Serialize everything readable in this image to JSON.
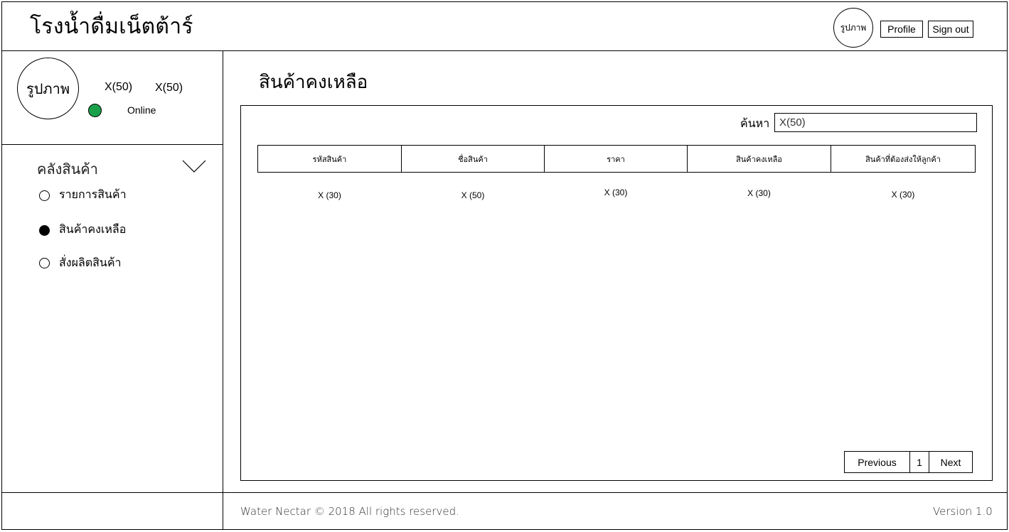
{
  "header": {
    "brand": "โรงน้ำดื่มเน็ตต้าร์",
    "avatar_label": "รูปภาพ",
    "profile_label": "Profile",
    "signout_label": "Sign out"
  },
  "user_panel": {
    "avatar_label": "รูปภาพ",
    "field1": "X(50)",
    "field2": "X(50)",
    "status_text": "Online",
    "status_color": "#1aa04a"
  },
  "sidebar": {
    "section_title": "คลังสินค้า",
    "items": [
      {
        "label": "รายการสินค้า",
        "selected": false
      },
      {
        "label": "สินค้าคงเหลือ",
        "selected": true
      },
      {
        "label": "สั่งผลิตสินค้า",
        "selected": false
      }
    ]
  },
  "main": {
    "page_title": "สินค้าคงเหลือ",
    "search_label": "ค้นหา",
    "search_value": "X(50)",
    "table": {
      "headers": [
        "รหัสสินค้า",
        "ชื่อสินค้า",
        "ราคา",
        "สินค้าคงเหลือ",
        "สินค้าที่ต้องส่งให้ลูกค้า"
      ],
      "rows": [
        [
          "X (30)",
          "X (50)",
          "X (30)",
          "X (30)",
          "X (30)"
        ]
      ]
    },
    "pagination": {
      "previous": "Previous",
      "page": "1",
      "next": "Next"
    }
  },
  "footer": {
    "copyright": "Water Nectar © 2018 All rights reserved.",
    "version": "Version 1.0"
  }
}
